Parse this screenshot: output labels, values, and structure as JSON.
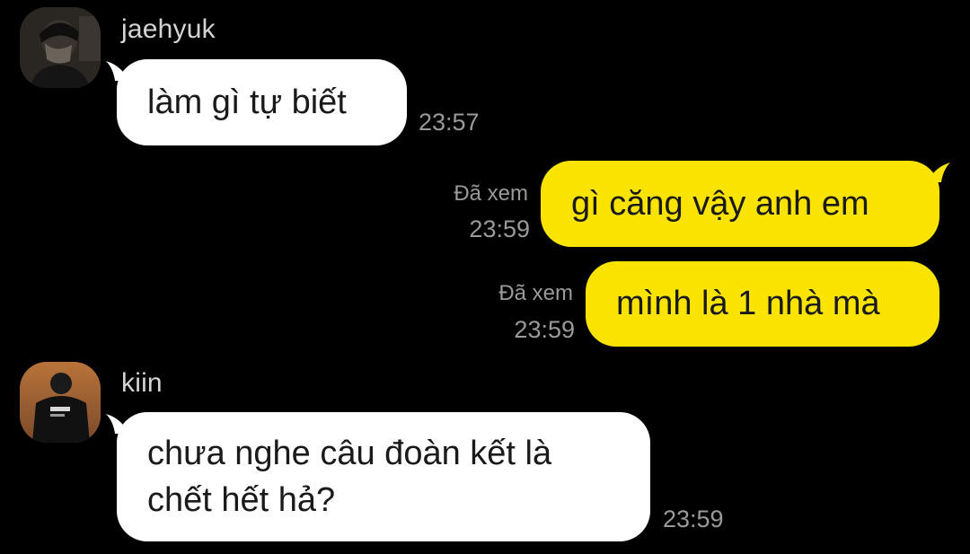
{
  "messages": [
    {
      "sender": "jaehyuk",
      "avatar_icon": "person-covering-face-avatar",
      "text": "làm gì tự biết",
      "time": "23:57"
    },
    {
      "sender": "me",
      "text": "gì căng vậy anh em",
      "seen": "Đã xem",
      "time": "23:59"
    },
    {
      "sender": "me",
      "text": "mình là 1 nhà mà",
      "seen": "Đã xem",
      "time": "23:59"
    },
    {
      "sender": "kiin",
      "avatar_icon": "person-back-view-avatar",
      "text_lines": [
        "chưa nghe câu đoàn kết là",
        "chết hết hả?"
      ],
      "time": "23:59"
    }
  ],
  "colors": {
    "background": "#000000",
    "incoming_bubble": "#ffffff",
    "outgoing_bubble": "#fbe300",
    "meta_text": "#9a9a9a",
    "sender_name": "#d4d4d4"
  }
}
